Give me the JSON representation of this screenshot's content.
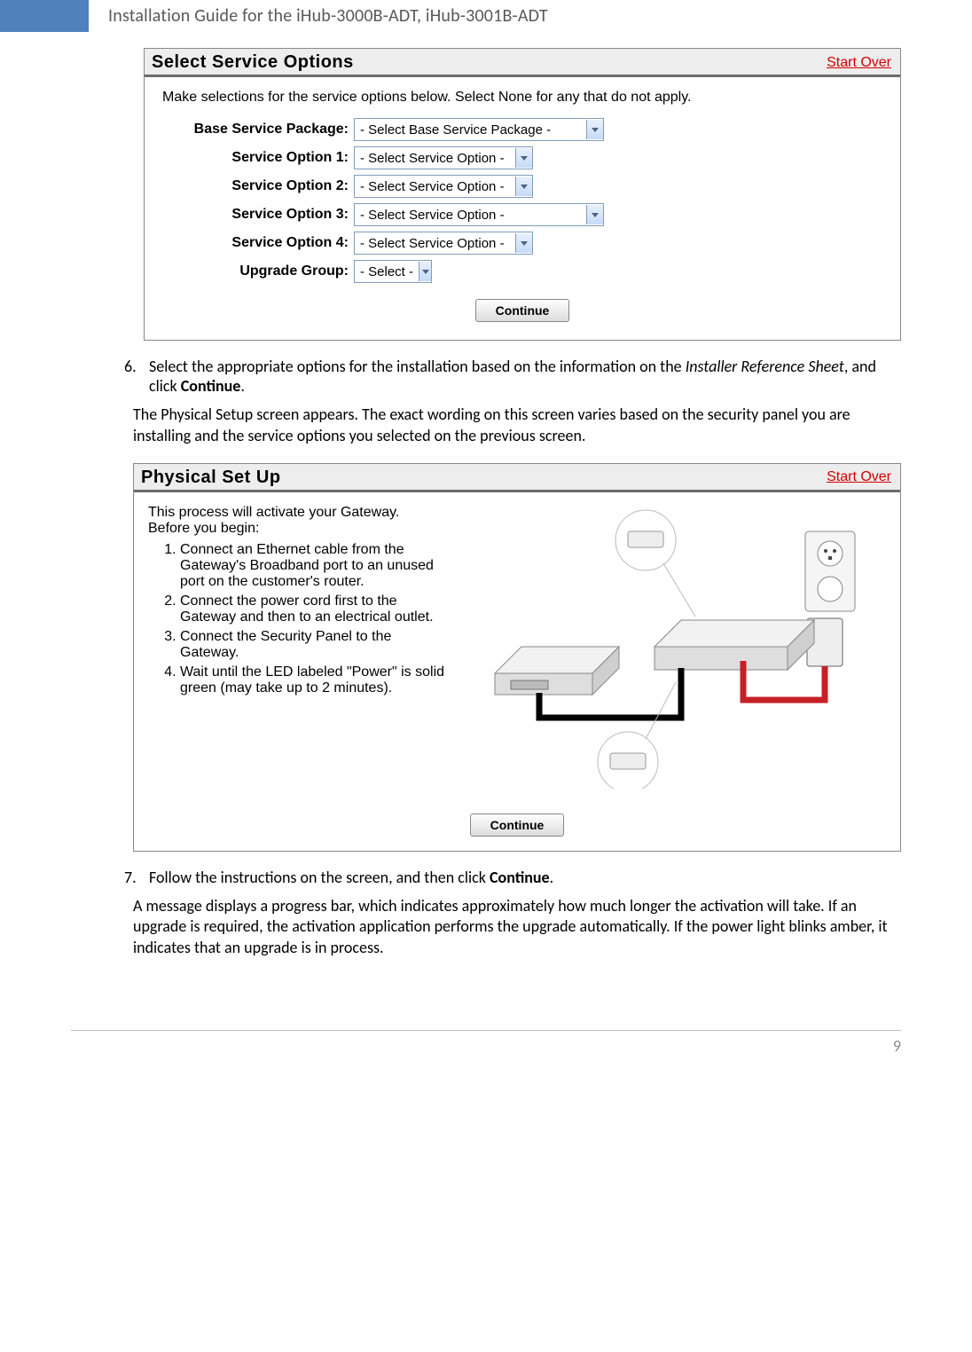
{
  "header": {
    "title": "Installation Guide for the iHub-3000B-ADT, iHub-3001B-ADT"
  },
  "panel1": {
    "title": "Select Service Options",
    "start_over": "Start Over",
    "intro": "Make selections for the service options below. Select None for any that do not apply.",
    "rows": {
      "base_label": "Base Service Package:",
      "base_value": "- Select Base Service Package -",
      "opt1_label": "Service Option 1:",
      "opt1_value": "- Select Service Option -",
      "opt2_label": "Service Option 2:",
      "opt2_value": "- Select Service Option -",
      "opt3_label": "Service Option 3:",
      "opt3_value": "- Select Service Option -",
      "opt4_label": "Service Option 4:",
      "opt4_value": "- Select Service Option -",
      "upgrade_label": "Upgrade Group:",
      "upgrade_value": "- Select -"
    },
    "continue": "Continue"
  },
  "step6": {
    "num": "6.",
    "text_before": "Select the appropriate options for the installation based on the information on the ",
    "italic": "Installer Reference Sheet",
    "text_mid": ", and click ",
    "bold": "Continue",
    "text_after": "."
  },
  "step6_follow": "The Physical Setup screen appears. The exact wording on this screen varies based on the security panel you are installing and the service options you selected on the previous screen.",
  "panel2": {
    "title": "Physical Set Up",
    "start_over": "Start Over",
    "intro1": "This process will activate your Gateway.",
    "intro2": "Before you begin:",
    "items": [
      "Connect an Ethernet cable from the Gateway's Broadband port to an unused port on the customer's router.",
      "Connect the power cord first to the Gateway and then to an electrical outlet.",
      "Connect the Security Panel to the Gateway.",
      "Wait until the LED labeled \"Power\" is solid green (may take up to 2 minutes)."
    ],
    "continue": "Continue"
  },
  "step7": {
    "num": "7.",
    "text_before": "Follow the instructions on the screen, and then click ",
    "bold": "Continue",
    "text_after": "."
  },
  "step7_follow": "A message displays a progress bar, which indicates approximately how much longer the activation will take. If an upgrade is required, the activation application performs the upgrade automatically. If the power light blinks amber, it indicates that an upgrade is in process.",
  "footer": {
    "page_number": "9"
  }
}
